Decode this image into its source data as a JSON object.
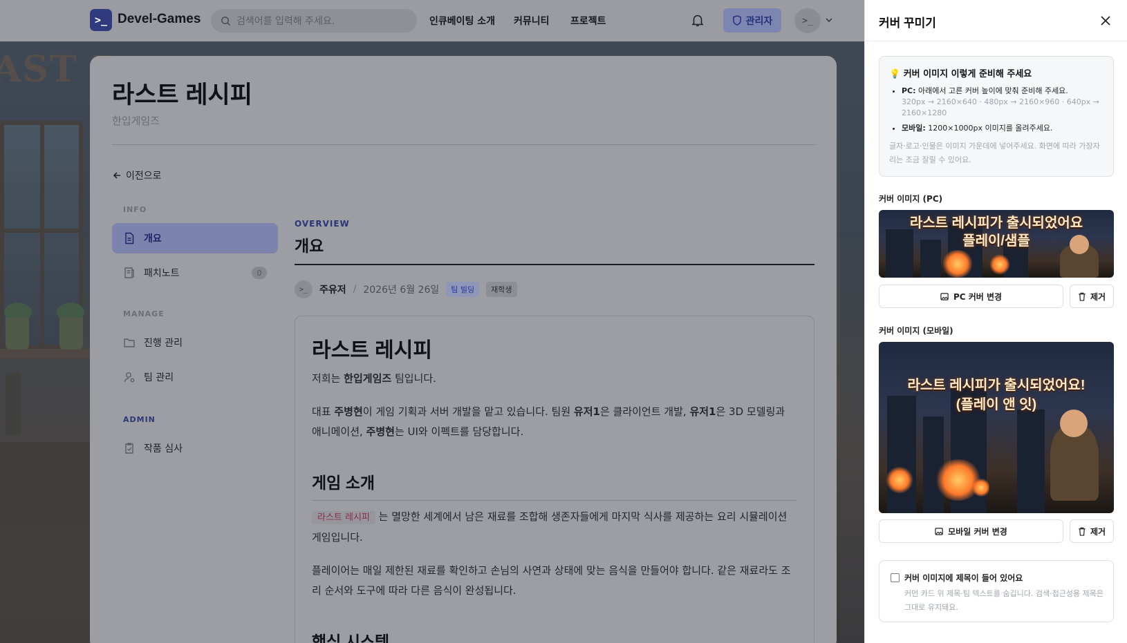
{
  "header": {
    "brand": "Devel-Games",
    "search_placeholder": "검색어를 입력해 주세요.",
    "nav": [
      "인큐베이팅 소개",
      "커뮤니티",
      "프로젝트"
    ],
    "admin_label": "관리자",
    "avatar_glyph": ">_",
    "logo_glyph": ">_"
  },
  "page": {
    "title": "라스트 레시피",
    "subtitle": "한입게임즈",
    "back_label": "이전으로"
  },
  "sidebar": {
    "sections": [
      "INFO",
      "MANAGE",
      "ADMIN"
    ],
    "items": [
      {
        "label": "개요",
        "icon": "document-icon",
        "active": true
      },
      {
        "label": "패치노트",
        "icon": "patchnote-icon",
        "count": "0"
      },
      {
        "label": "진행 관리",
        "icon": "folder-icon"
      },
      {
        "label": "팀 관리",
        "icon": "user-icon"
      },
      {
        "label": "작품 심사",
        "icon": "clipboard-icon"
      }
    ]
  },
  "overview": {
    "eyebrow": "OVERVIEW",
    "title": "개요",
    "author": "주유저",
    "separator": "/",
    "date": "2026년 6월 26일",
    "tags": [
      "팀 빌딩",
      "재학생"
    ]
  },
  "article": {
    "h1": "라스트 레시피",
    "p1_pre": "저희는 ",
    "p1_bold": "한입게임즈",
    "p1_post": " 팀입니다.",
    "p2": [
      {
        "t": "대표 ",
        "b": false
      },
      {
        "t": "주병현",
        "b": true
      },
      {
        "t": "이 게임 기획과 서버 개발을 맡고 있습니다. 팀원 ",
        "b": false
      },
      {
        "t": "유저1",
        "b": true
      },
      {
        "t": "은 클라이언트 개발, ",
        "b": false
      },
      {
        "t": "유저1",
        "b": true
      },
      {
        "t": "은 3D 모델링과 애니메이션, ",
        "b": false
      },
      {
        "t": "주병현",
        "b": true
      },
      {
        "t": "는 UI와 이펙트를 담당합니다.",
        "b": false
      }
    ],
    "h2": "게임 소개",
    "code": "라스트 레시피",
    "p3": " 는 멸망한 세계에서 남은 재료를 조합해 생존자들에게 마지막 식사를 제공하는 요리 시뮬레이션 게임입니다.",
    "p4": "플레이어는 매일 제한된 재료를 확인하고 손님의 사연과 상태에 맞는 음식을 만들어야 합니다. 같은 재료라도 조리 순서와 도구에 따라 다른 음식이 완성됩니다.",
    "h3": "핵심 시스템"
  },
  "panel": {
    "title": "커버 꾸미기",
    "tip_title": "커버 이미지 이렇게 준비해 주세요",
    "tip_pc_label": "PC:",
    "tip_pc_text": "아래에서 고른 커버 높이에 맞춰 준비해 주세요.",
    "tip_pc_sizes": "320px → 2160×640 · 480px → 2160×960 · 640px → 2160×1280",
    "tip_mobile_label": "모바일:",
    "tip_mobile_text": "1200×1000px 이미지를 올려주세요.",
    "tip_note": "글자·로고·인물은 이미지 가운데에 넣어주세요. 화면에 따라 가장자리는 조금 잘릴 수 있어요.",
    "pc_label": "커버 이미지 (PC)",
    "pc_caption_1": "라스트 레시피가 출시되었어요",
    "pc_caption_2": "플레이/샘플",
    "pc_change": "PC 커버 변경",
    "remove": "제거",
    "mobile_label": "커버 이미지 (모바일)",
    "mobile_caption_1": "라스트 레시피가 출시되었어요!",
    "mobile_caption_2": "(플레이 앤 잇)",
    "mobile_change": "모바일 커버 변경",
    "checkbox_label": "커버 이미지에 제목이 들어 있어요",
    "checkbox_desc": "커먼 카드 위 제목·팀 텍스트를 숨깁니다. 검색·접근성용 제목은 그대로 유지돼요.",
    "checkbox_checked": false
  }
}
